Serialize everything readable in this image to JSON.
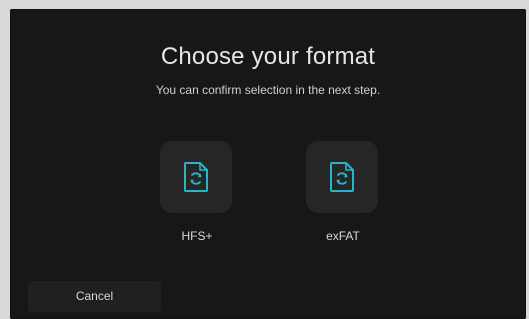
{
  "dialog": {
    "title": "Choose your format",
    "subtitle": "You can confirm selection in the next step."
  },
  "formats": [
    {
      "label": "HFS+",
      "icon": "file-format-icon"
    },
    {
      "label": "exFAT",
      "icon": "file-format-icon"
    }
  ],
  "footer": {
    "cancel_label": "Cancel"
  },
  "colors": {
    "accent": "#2bb3c9",
    "dialog_background": "#171717",
    "tile_background": "#262626"
  }
}
